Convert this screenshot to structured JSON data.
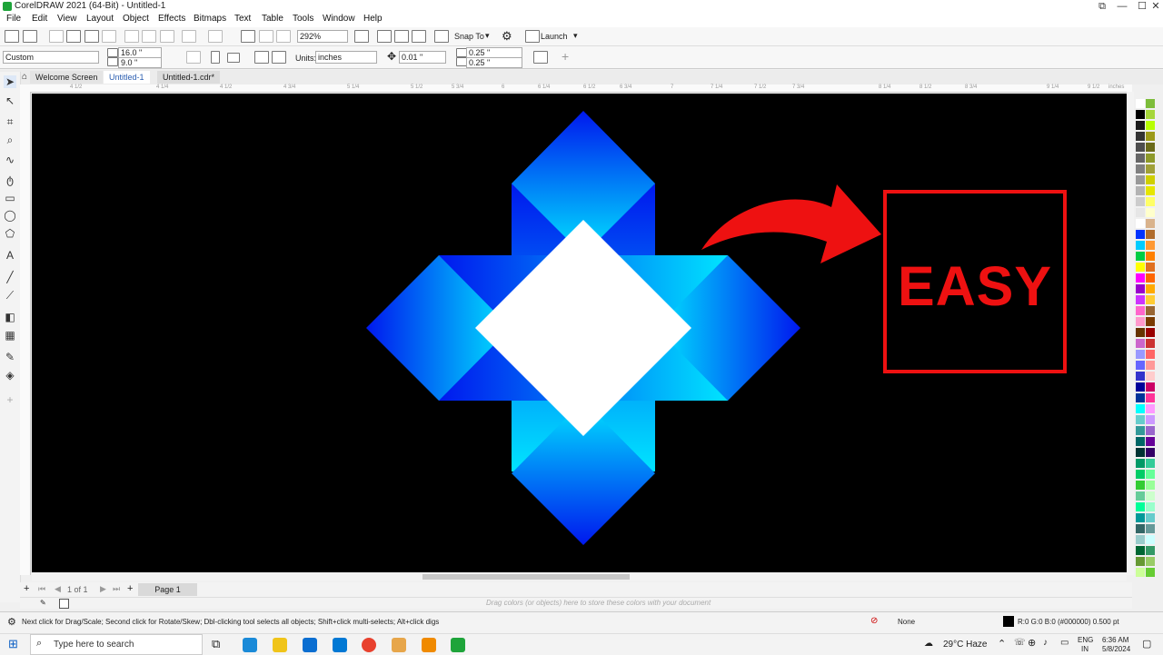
{
  "app": {
    "title": "CorelDRAW 2021 (64-Bit) - Untitled-1",
    "window_controls": [
      "⧉",
      "—",
      "☐",
      "✕"
    ]
  },
  "menu": [
    "File",
    "Edit",
    "View",
    "Layout",
    "Object",
    "Effects",
    "Bitmaps",
    "Text",
    "Table",
    "Tools",
    "Window",
    "Help"
  ],
  "toolbar": {
    "zoom": "292%",
    "snap_to": "Snap To",
    "launch": "Launch"
  },
  "property_bar": {
    "page_preset": "Custom",
    "width": "16.0 \"",
    "height": "9.0 \"",
    "units_label": "Units:",
    "units_value": "inches",
    "nudge": "0.01 \"",
    "dup_x": "0.25 \"",
    "dup_y": "0.25 \""
  },
  "tabs": [
    {
      "label": "Welcome Screen"
    },
    {
      "label": "Untitled-1"
    },
    {
      "label": "Untitled-1.cdr*"
    }
  ],
  "ruler_labels": [
    "4 1/2",
    "4 1/4",
    "4 1/2",
    "4 3/4",
    "5 1/4",
    "5 1/2",
    "5 3/4",
    "6",
    "6 1/4",
    "6 1/2",
    "6 3/4",
    "7",
    "7 1/4",
    "7 1/2",
    "7 3/4",
    "8 1/4",
    "8 1/2",
    "8 3/4",
    "9 1/4",
    "9 1/2",
    "inches"
  ],
  "canvas": {
    "easy_text": "EASY",
    "arrow_color": "#ee1111",
    "gradient_dark": "#0010ee",
    "gradient_light": "#00e0ff"
  },
  "page_nav": {
    "count": "1 of 1",
    "page_tab": "Page 1"
  },
  "doc_palette_hint": "Drag colors (or objects) here to store these colors with your document",
  "status": {
    "hint": "Next click for Drag/Scale; Second click for Rotate/Skew; Dbl-clicking tool selects all objects; Shift+click multi-selects; Alt+click digs",
    "fill": "None",
    "color_info": "R:0 G:0 B:0 (#000000)  0.500 pt"
  },
  "taskbar": {
    "search_placeholder": "Type here to search",
    "weather": "29°C  Haze",
    "lang": "ENG",
    "region": "IN",
    "time": "6:36 AM",
    "date": "5/8/2024"
  },
  "palette_colors": [
    [
      "#ffffff",
      "#7dbd3a"
    ],
    [
      "#000000",
      "#a5d63a"
    ],
    [
      "#1a1a1a",
      "#b7ff00"
    ],
    [
      "#333333",
      "#9c9a18"
    ],
    [
      "#4d4d4d",
      "#6b6b1a"
    ],
    [
      "#666666",
      "#8e9a2a"
    ],
    [
      "#808080",
      "#a0a038"
    ],
    [
      "#999999",
      "#cfcf00"
    ],
    [
      "#b3b3b3",
      "#e6e600"
    ],
    [
      "#cccccc",
      "#ffff66"
    ],
    [
      "#e6e6e6",
      "#ffffcc"
    ],
    [
      "#ffffff",
      "#d9b38c"
    ],
    [
      "#0033ff",
      "#b06c2c"
    ],
    [
      "#00ccff",
      "#ff9933"
    ],
    [
      "#00cc44",
      "#ff8000"
    ],
    [
      "#ffff00",
      "#e07020"
    ],
    [
      "#ff00ff",
      "#ff6600"
    ],
    [
      "#9900cc",
      "#ffaa00"
    ],
    [
      "#cc33ff",
      "#ffcc33"
    ],
    [
      "#ff66cc",
      "#996633"
    ],
    [
      "#ff99cc",
      "#7a3b00"
    ],
    [
      "#663300",
      "#990000"
    ],
    [
      "#cc66cc",
      "#cc3333"
    ],
    [
      "#9999ff",
      "#ff6666"
    ],
    [
      "#6666ff",
      "#ff9999"
    ],
    [
      "#3333cc",
      "#ffcccc"
    ],
    [
      "#000099",
      "#cc0066"
    ],
    [
      "#003399",
      "#ff3399"
    ],
    [
      "#00ffff",
      "#ff99ff"
    ],
    [
      "#66cccc",
      "#cc99ff"
    ],
    [
      "#339999",
      "#9966cc"
    ],
    [
      "#006666",
      "#660099"
    ],
    [
      "#003333",
      "#330066"
    ],
    [
      "#009966",
      "#33cc99"
    ],
    [
      "#00cc66",
      "#66ff99"
    ],
    [
      "#33cc33",
      "#99ff99"
    ],
    [
      "#66cc99",
      "#ccffcc"
    ],
    [
      "#00ff99",
      "#99ffcc"
    ],
    [
      "#009999",
      "#66cccc"
    ],
    [
      "#336666",
      "#669999"
    ],
    [
      "#99cccc",
      "#ccffff"
    ],
    [
      "#006633",
      "#339966"
    ],
    [
      "#669933",
      "#99cc66"
    ],
    [
      "#ccff99",
      "#66cc33"
    ]
  ]
}
